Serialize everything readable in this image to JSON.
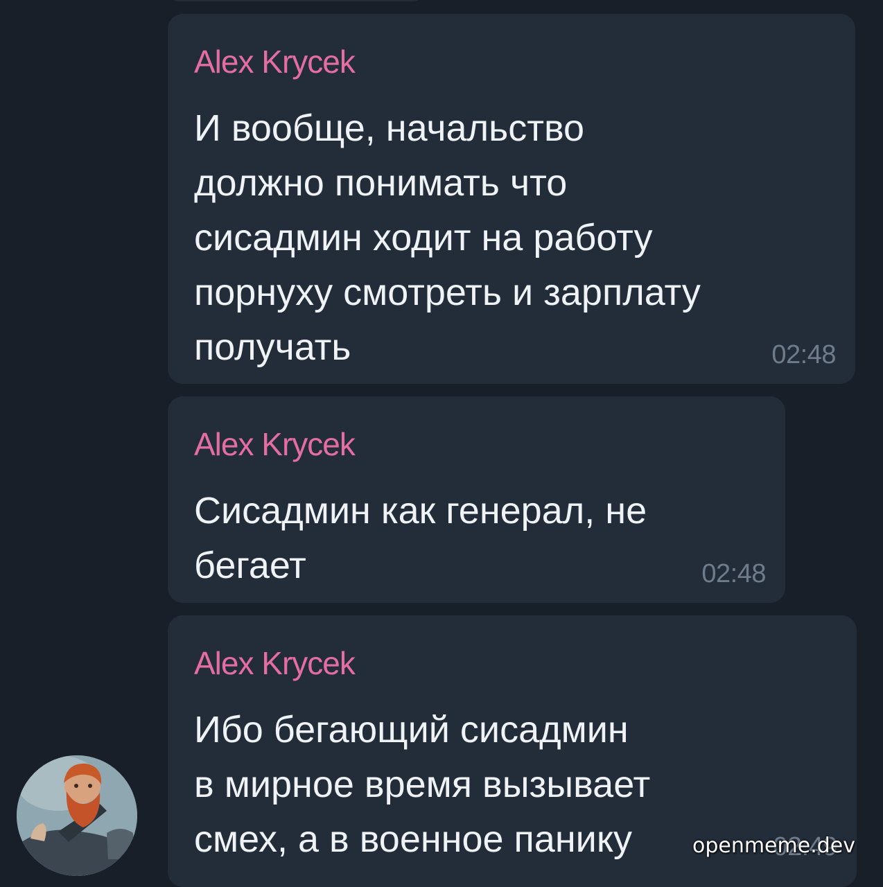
{
  "messages": [
    {
      "sender": "Alex Krycek",
      "text": "И вообще, начальство\nдолжно понимать что\nсисадмин ходит на работу\nпорнуху смотреть и зарплату\nполучать",
      "time": "02:48"
    },
    {
      "sender": "Alex Krycek",
      "text": "Сисадмин как генерал, не\nбегает",
      "time": "02:48"
    },
    {
      "sender": "Alex Krycek",
      "text": "Ибо бегающий сисадмин\nв мирное время вызывает\nсмех, а в военное панику",
      "time": "02:49"
    }
  ],
  "watermark": "openmeme.dev",
  "colors": {
    "background": "#181f29",
    "bubble": "#232d3a",
    "sender_name": "#e46ea2",
    "message_text": "#f0f3f6",
    "timestamp": "#6e7c8c"
  },
  "avatar": {
    "icon": "user-avatar-bearded-warrior"
  }
}
